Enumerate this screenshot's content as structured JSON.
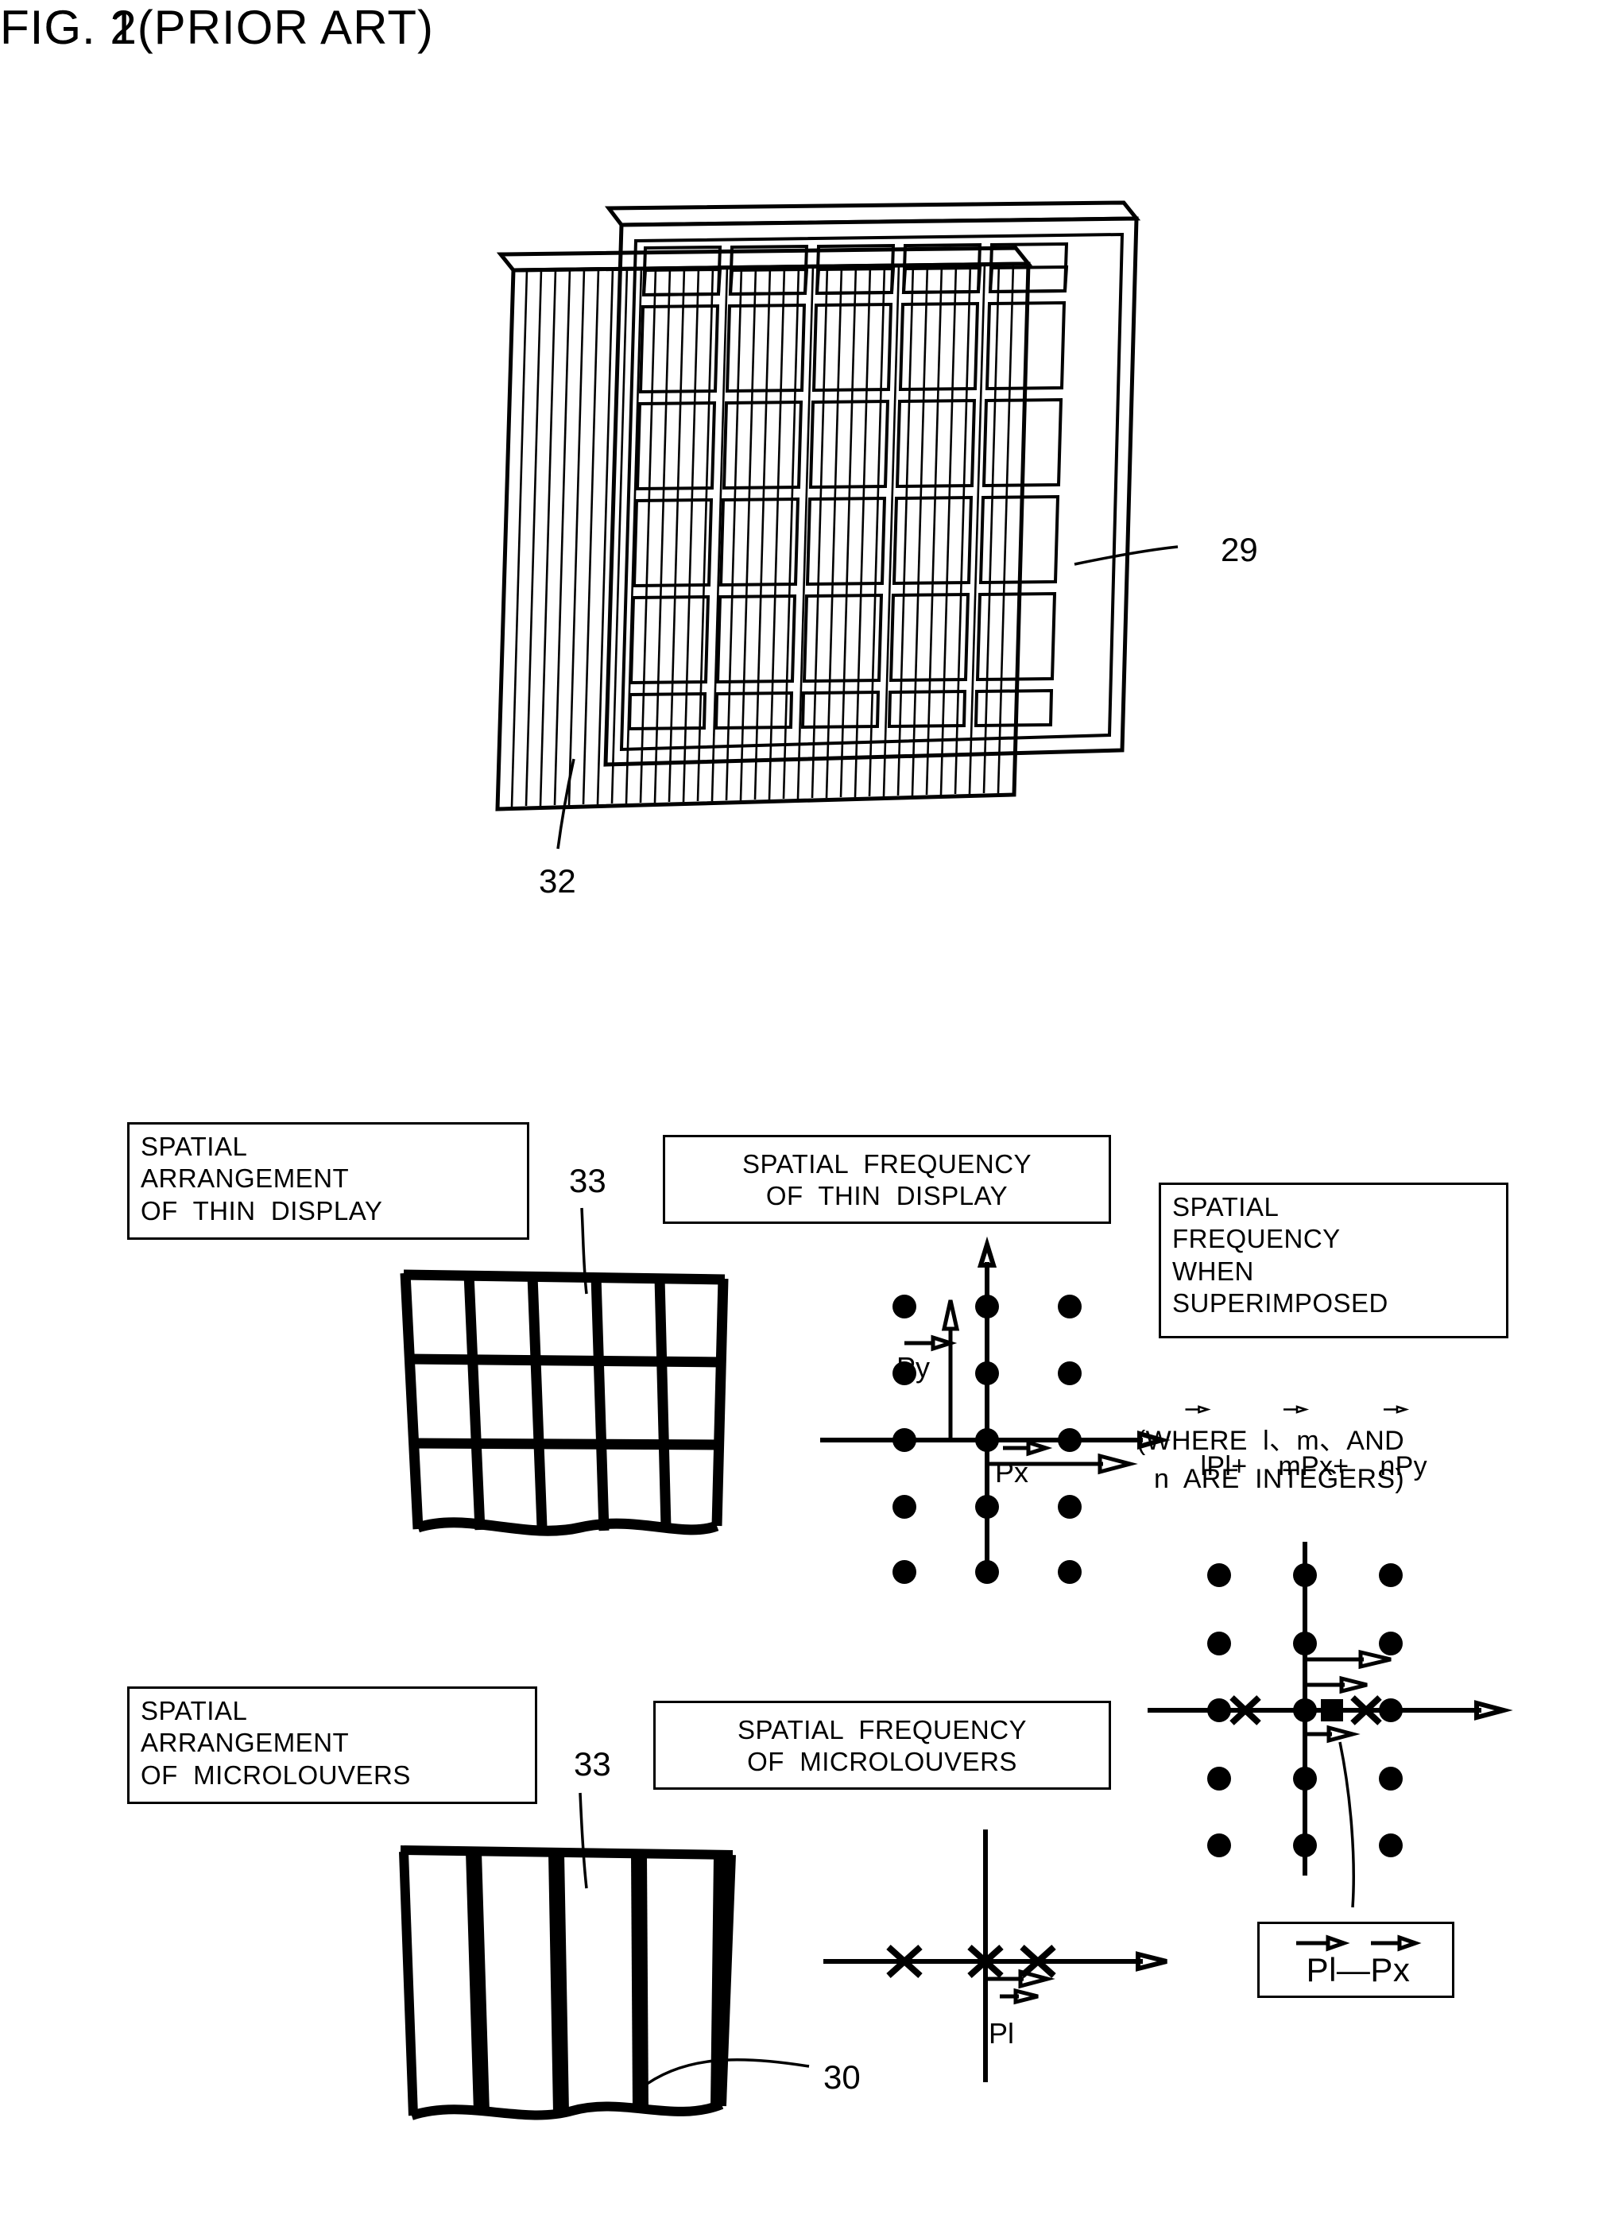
{
  "figures": {
    "fig1": {
      "title": "FIG. 1",
      "refs": [
        {
          "id": "29",
          "label": "29"
        },
        {
          "id": "32",
          "label": "32"
        }
      ]
    },
    "fig2": {
      "title": "FIG. 2(PRIOR ART)",
      "boxes": {
        "spatial_arrangement_thin_display": "SPATIAL\nARRANGEMENT\nOF  THIN  DISPLAY",
        "spatial_frequency_thin_display": "SPATIAL  FREQUENCY\nOF  THIN  DISPLAY",
        "spatial_frequency_superimposed": "SPATIAL\nFREQUENCY\nWHEN\nSUPERIMPOSED",
        "spatial_arrangement_microlouvers": "SPATIAL\nARRANGEMENT\nOF  MICROLOUVERS",
        "spatial_frequency_microlouvers": "SPATIAL  FREQUENCY\nOF  MICROLOUVERS",
        "pl_minus_px": "Pl—Px"
      },
      "formula": {
        "line1_terms": [
          "lPl",
          "+",
          "mPx",
          "+",
          "nPy"
        ],
        "line2": "(WHERE  l、m、AND",
        "line3": "n  ARE  INTEGERS)"
      },
      "plot_labels": {
        "py": "Py",
        "px": "Px",
        "pl": "Pl"
      },
      "refs": [
        {
          "id": "33a",
          "label": "33"
        },
        {
          "id": "33b",
          "label": "33"
        },
        {
          "id": "30",
          "label": "30"
        }
      ]
    }
  },
  "chart_data": [
    {
      "type": "scatter",
      "name": "spatial-frequency-of-thin-display",
      "title": "SPATIAL  FREQUENCY OF  THIN  DISPLAY",
      "marker": "filled-circle",
      "x": [
        -1,
        0,
        1,
        -1,
        0,
        1,
        -1,
        0,
        1,
        -1,
        0,
        1,
        -1,
        0,
        1
      ],
      "y": [
        2,
        2,
        2,
        1,
        1,
        1,
        0,
        0,
        0,
        -1,
        -1,
        -1,
        -2,
        -2,
        -2
      ],
      "axes": "cartesian-cross",
      "annotations": [
        "Py",
        "Px"
      ]
    },
    {
      "type": "scatter",
      "name": "spatial-frequency-of-microlouvers",
      "title": "SPATIAL  FREQUENCY OF  MICROLOUVERS",
      "marker": "cross",
      "x": [
        -1,
        0,
        1
      ],
      "y": [
        0,
        0,
        0
      ],
      "axes": "cartesian-cross",
      "annotations": [
        "Pl"
      ]
    },
    {
      "type": "scatter",
      "name": "spatial-frequency-when-superimposed",
      "title": "SPATIAL  FREQUENCY  WHEN  SUPERIMPOSED",
      "markers": [
        "filled-circle",
        "cross",
        "filled-square"
      ],
      "circles_x": [
        -1,
        0,
        1,
        -1,
        0,
        1,
        -1,
        0,
        1,
        -1,
        0,
        1,
        -1,
        0,
        1
      ],
      "circles_y": [
        2,
        2,
        2,
        1,
        1,
        1,
        0,
        0,
        0,
        -1,
        -1,
        -1,
        -2,
        -2,
        -2
      ],
      "crosses_x": [
        -0.72,
        0.62
      ],
      "crosses_y": [
        0,
        0
      ],
      "squares_x": [
        0.26
      ],
      "squares_y": [
        0
      ],
      "axes": "cartesian-cross",
      "annotations": [
        "Pl—Px"
      ]
    }
  ]
}
